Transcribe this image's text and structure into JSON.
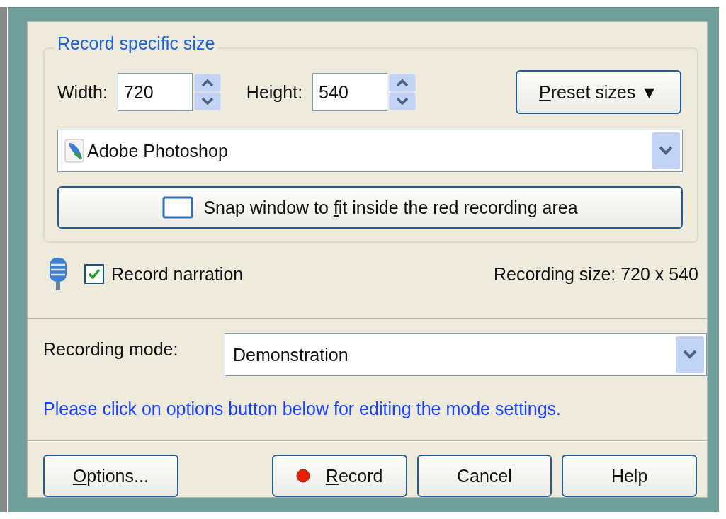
{
  "size_group": {
    "title": "Record specific size",
    "width": {
      "label": "Width:",
      "value": "720"
    },
    "height": {
      "label": "Height:",
      "value": "540"
    },
    "preset_button": {
      "key": "P",
      "post": "reset sizes ▼"
    },
    "application": {
      "value": "Adobe Photoshop"
    },
    "snap_button": {
      "pre": "Snap window to ",
      "key": "f",
      "post": "it inside the red recording area"
    }
  },
  "narration": {
    "label": "Record narration",
    "checked": true
  },
  "recording_size": "Recording size: 720 x 540",
  "mode": {
    "label": "Recording mode:",
    "value": "Demonstration"
  },
  "hint": "Please click on options button below for editing the mode settings.",
  "buttons": [
    {
      "kind": "plain",
      "key": "O",
      "post": "ptions..."
    },
    {
      "kind": "record",
      "key": "R",
      "post": "ecord"
    },
    {
      "kind": "plain",
      "pre": "Cancel"
    },
    {
      "kind": "plain",
      "pre": "Help"
    }
  ]
}
